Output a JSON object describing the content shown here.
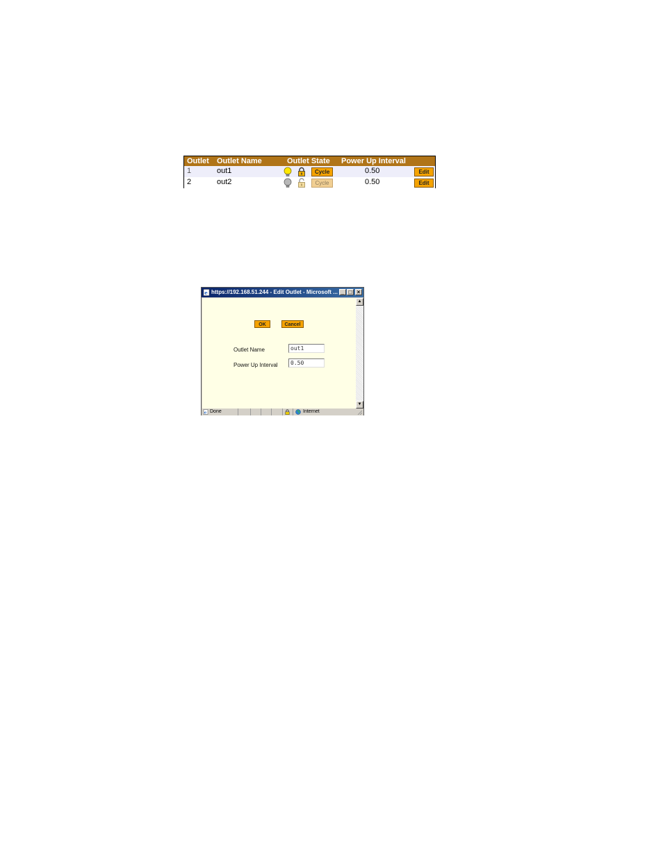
{
  "outlet_table": {
    "headers": {
      "outlet": "Outlet",
      "outlet_name": "Outlet Name",
      "outlet_state": "Outlet State",
      "power_up_interval": "Power Up Interval"
    },
    "rows": [
      {
        "outlet": "1",
        "name": "out1",
        "state": "on",
        "locked": true,
        "cycle_label": "Cycle",
        "interval": "0.50",
        "edit_label": "Edit"
      },
      {
        "outlet": "2",
        "name": "out2",
        "state": "off",
        "locked": false,
        "cycle_label": "Cycle",
        "interval": "0.50",
        "edit_label": "Edit"
      }
    ],
    "colors": {
      "header_bg": "#b07418",
      "button_bg": "#f5a300",
      "row_alt_bg": "#eeeefa"
    }
  },
  "edit_window": {
    "title": "https://192.168.51.244 - Edit Outlet - Microsoft ...",
    "window_controls": {
      "minimize": "_",
      "maximize": "□",
      "close": "×"
    },
    "ok_label": "OK",
    "cancel_label": "Cancel",
    "fields": {
      "outlet_name_label": "Outlet Name",
      "outlet_name_value": "out1",
      "power_up_interval_label": "Power Up Interval",
      "power_up_interval_value": "0.50"
    },
    "statusbar": {
      "status": "Done",
      "zone": "Internet"
    },
    "colors": {
      "content_bg": "#ffffe6",
      "titlebar": "#0a246a"
    },
    "icons": [
      "ie-page-icon",
      "lock-icon",
      "globe-icon"
    ]
  }
}
